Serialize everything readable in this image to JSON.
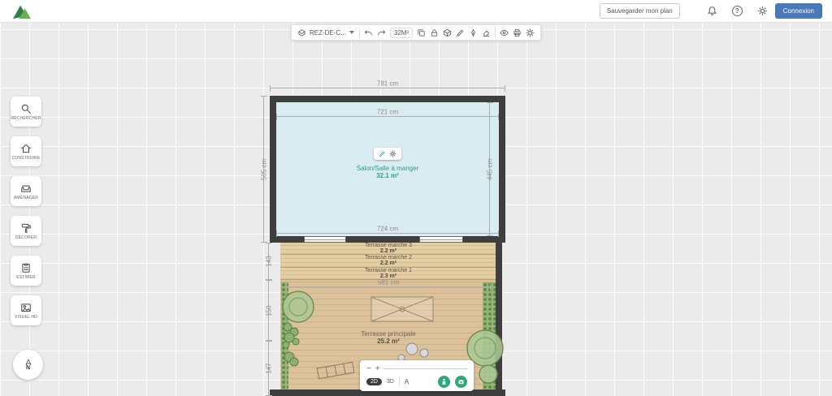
{
  "header": {
    "save_button": "Sauvegarder mon plan",
    "connect_button": "Connexion",
    "help_glyph": "?"
  },
  "top_toolbar": {
    "floor_selector": "REZ-DE-C...",
    "area_badge": "32M²"
  },
  "sidebar": {
    "items": [
      {
        "label": "RECHERCHER"
      },
      {
        "label": "CONSTRUIRE"
      },
      {
        "label": "AMÉNAGER"
      },
      {
        "label": "DÉCORER"
      },
      {
        "label": "ESTIMER"
      },
      {
        "label": "VISUEL HD"
      }
    ],
    "compass_label": "N"
  },
  "plan": {
    "room_salon": {
      "name": "Salon/Salle à manger",
      "area": "32.1 m²"
    },
    "terrace_steps": [
      {
        "name": "Terrasse marche 3",
        "area": "2.2 m²"
      },
      {
        "name": "Terrasse marche 2",
        "area": "2.2 m²"
      },
      {
        "name": "Terrasse marche 1",
        "area": "2.3 m²"
      }
    ],
    "terrace_main": {
      "name": "Terrasse principale",
      "area": "25.2 m²"
    },
    "dimensions": {
      "outer_width": "781 cm",
      "inner_width_top": "721 cm",
      "inner_width_bottom": "724 cm",
      "outer_height_left": "505 cm",
      "inner_height_right": "445 cm",
      "terrace_width": "581 cm",
      "terrace_steps_height": "143",
      "terrace_mid_height": "150",
      "terrace_bottom_height": "147"
    }
  },
  "bottom_toolbar": {
    "zoom_out": "−",
    "zoom_in": "+",
    "mode_2d": "2D",
    "mode_3d": "3D",
    "text_tool": "A"
  },
  "colors": {
    "accent_green": "#2e9c82",
    "button_blue": "#4a79b8",
    "wall": "#3e3e3e",
    "room_fill": "#d9ecf1",
    "terrace_fill": "#dcc29a"
  }
}
